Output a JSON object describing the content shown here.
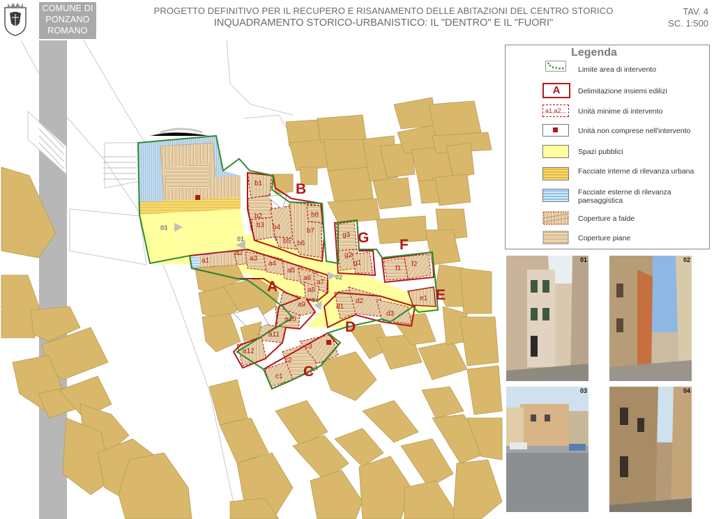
{
  "header": {
    "comune_lines": [
      "COMUNE DI",
      "PONZANO",
      "ROMANO"
    ],
    "title_line1": "PROGETTO DEFINITIVO PER IL RECUPERO E RISANAMENTO DELLE ABITAZIONI DEL CENTRO STORICO",
    "title_line2": "INQUADRAMENTO STORICO-URBANISTICO: IL \"DENTRO\" E IL \"FUORI\"",
    "sheet": "TAV. 4",
    "scale": "SC. 1:500"
  },
  "legend": {
    "title": "Legenda",
    "items": [
      {
        "key": "limite",
        "label": "Limite area di intervento"
      },
      {
        "key": "insiemi",
        "label": "Delimitazione insiemi edilizi",
        "symbol": "A"
      },
      {
        "key": "unita",
        "label": "Unità minime di intervento",
        "symbol": "a1,a2..."
      },
      {
        "key": "non-comprese",
        "label": "Unità non comprese nell'intervento"
      },
      {
        "key": "spazi",
        "label": "Spazi pubblici"
      },
      {
        "key": "facciate-interne",
        "label": "Facciate interne di rilevanza urbana"
      },
      {
        "key": "facciate-esterne",
        "label": "Facciate esterne di rilevanza paesaggistica"
      },
      {
        "key": "coperture-falde",
        "label": "Coperture a falde"
      },
      {
        "key": "coperture-piane",
        "label": "Coperture piane"
      }
    ]
  },
  "colors": {
    "building": "#d9b86c",
    "building_stroke": "#b89a50",
    "public_space": "#ffff9e",
    "boundary": "#2e8b2e",
    "unit_border": "#b01818",
    "road": "#b5b5b5",
    "facade_inner": "#f2c84b",
    "facade_outer": "#a8d0ee"
  },
  "map": {
    "blocks": [
      "A",
      "B",
      "C",
      "D",
      "E",
      "F",
      "G"
    ],
    "units": [
      "a1",
      "a2",
      "a3",
      "a4",
      "a5",
      "a6",
      "a7",
      "a8",
      "a9",
      "a10",
      "a11",
      "a12",
      "b1",
      "b2",
      "b3",
      "b4",
      "b5",
      "b6",
      "b7",
      "b8",
      "c1",
      "c2",
      "c3",
      "d1",
      "d2",
      "d3",
      "e1",
      "f1",
      "f2",
      "g1",
      "g2",
      "g3"
    ],
    "viewpoints": [
      "01",
      "02",
      "03",
      "04"
    ]
  },
  "photos": [
    {
      "num": "01",
      "subject": "street"
    },
    {
      "num": "02",
      "subject": "street"
    },
    {
      "num": "03",
      "subject": "square"
    },
    {
      "num": "04",
      "subject": "street"
    }
  ]
}
